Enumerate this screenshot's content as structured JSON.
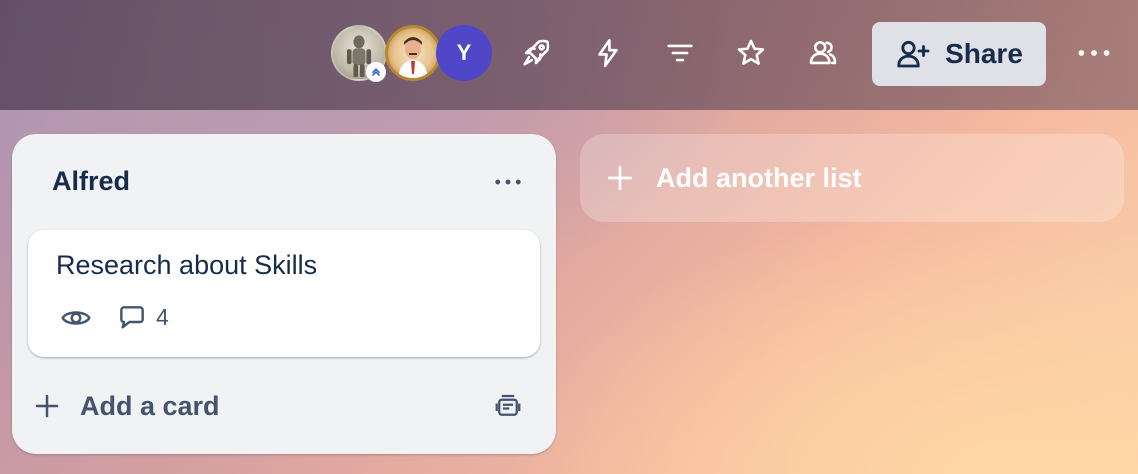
{
  "header": {
    "members": [
      {
        "name": "member-avatar-robot",
        "icon": "robot-avatar-image"
      },
      {
        "name": "member-avatar-man",
        "icon": "man-portrait-avatar-image"
      },
      {
        "name": "member-avatar-y",
        "initial": "Y",
        "color": "#5046c8"
      }
    ],
    "icons": [
      "rocket-icon",
      "lightning-icon",
      "filter-icon",
      "star-icon",
      "team-visibility-icon"
    ],
    "share_label": "Share",
    "more_icon": "more-horizontal-icon"
  },
  "list": {
    "title": "Alfred",
    "cards": [
      {
        "title": "Research about Skills",
        "watching": true,
        "comment_count": "4"
      }
    ],
    "add_card_label": "Add a card"
  },
  "add_list_label": "Add another list",
  "colors": {
    "share_bg": "#dfe1e6",
    "list_bg": "#f1f2f4",
    "text_primary": "#172b4d",
    "text_secondary": "#44546f",
    "avatar_y": "#5046c8"
  }
}
